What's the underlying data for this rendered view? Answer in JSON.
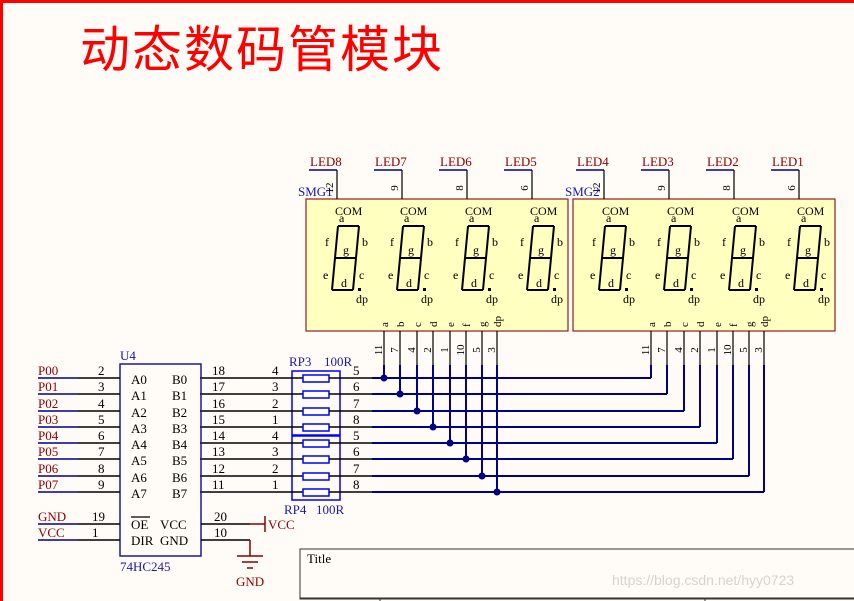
{
  "page": {
    "title": "动态数码管模块",
    "watermark": "https://blog.csdn.net/hyy0723",
    "title_block_label": "Title"
  },
  "colors": {
    "frame": "#ff0000",
    "title": "#ff0000",
    "wire": "#00008b",
    "pin": "#000000",
    "net_label": "#8b0000",
    "component": "#1a1aa6",
    "display_fill": "#ffffc0",
    "display_border": "#8b2020",
    "resistor": "#0000ff"
  },
  "displays": [
    {
      "designator": "SMG1",
      "digits": [
        {
          "net": "LED8",
          "com_pin": "12"
        },
        {
          "net": "LED7",
          "com_pin": "9"
        },
        {
          "net": "LED6",
          "com_pin": "8"
        },
        {
          "net": "LED5",
          "com_pin": "6"
        }
      ]
    },
    {
      "designator": "SMG2",
      "digits": [
        {
          "net": "LED4",
          "com_pin": "12"
        },
        {
          "net": "LED3",
          "com_pin": "9"
        },
        {
          "net": "LED2",
          "com_pin": "8"
        },
        {
          "net": "LED1",
          "com_pin": "6"
        }
      ]
    }
  ],
  "digit_labels": {
    "com": "COM",
    "a": "a",
    "b": "b",
    "c": "c",
    "d": "d",
    "e": "e",
    "f": "f",
    "g": "g",
    "dp": "dp"
  },
  "segment_pins": [
    {
      "segment": "a",
      "pin": "11"
    },
    {
      "segment": "b",
      "pin": "7"
    },
    {
      "segment": "c",
      "pin": "4"
    },
    {
      "segment": "d",
      "pin": "2"
    },
    {
      "segment": "e",
      "pin": "1"
    },
    {
      "segment": "f",
      "pin": "10"
    },
    {
      "segment": "g",
      "pin": "5"
    },
    {
      "segment": "dp",
      "pin": "3"
    }
  ],
  "buffer": {
    "designator": "U4",
    "part": "74HC245",
    "a_side": [
      {
        "net": "P00",
        "pin": "2",
        "name": "A0"
      },
      {
        "net": "P01",
        "pin": "3",
        "name": "A1"
      },
      {
        "net": "P02",
        "pin": "4",
        "name": "A2"
      },
      {
        "net": "P03",
        "pin": "5",
        "name": "A3"
      },
      {
        "net": "P04",
        "pin": "6",
        "name": "A4"
      },
      {
        "net": "P05",
        "pin": "7",
        "name": "A5"
      },
      {
        "net": "P06",
        "pin": "8",
        "name": "A6"
      },
      {
        "net": "P07",
        "pin": "9",
        "name": "A7"
      }
    ],
    "b_side": [
      {
        "pin": "18",
        "name": "B0"
      },
      {
        "pin": "17",
        "name": "B1"
      },
      {
        "pin": "16",
        "name": "B2"
      },
      {
        "pin": "15",
        "name": "B3"
      },
      {
        "pin": "14",
        "name": "B4"
      },
      {
        "pin": "13",
        "name": "B5"
      },
      {
        "pin": "12",
        "name": "B6"
      },
      {
        "pin": "11",
        "name": "B7"
      }
    ],
    "control": [
      {
        "net": "GND",
        "pin": "19",
        "name": "OE",
        "overline": true
      },
      {
        "net": "VCC",
        "pin": "1",
        "name": "DIR"
      }
    ],
    "power": [
      {
        "pin": "20",
        "name": "VCC",
        "net": "VCC"
      },
      {
        "pin": "10",
        "name": "GND",
        "net": "GND"
      }
    ]
  },
  "resistor_packs": [
    {
      "designator": "RP3",
      "value": "100R",
      "left_pins": [
        "4",
        "3",
        "2",
        "1"
      ],
      "right_pins": [
        "5",
        "6",
        "7",
        "8"
      ]
    },
    {
      "designator": "RP4",
      "value": "100R",
      "left_pins": [
        "4",
        "3",
        "2",
        "1"
      ],
      "right_pins": [
        "5",
        "6",
        "7",
        "8"
      ]
    }
  ]
}
